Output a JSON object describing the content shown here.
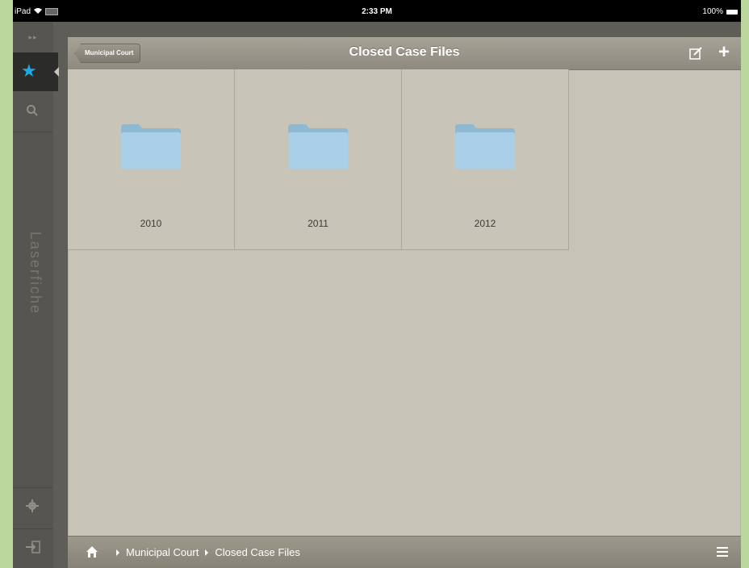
{
  "statusbar": {
    "device": "iPad",
    "time": "2:33 PM",
    "battery": "100%"
  },
  "sidebar": {
    "collapse_label": "▸▸",
    "brand": "Laserfiche"
  },
  "navbar": {
    "back_label": "Municipal Court",
    "title": "Closed Case Files"
  },
  "folders": [
    {
      "label": "2010"
    },
    {
      "label": "2011"
    },
    {
      "label": "2012"
    }
  ],
  "breadcrumb": {
    "items": [
      "Municipal Court",
      "Closed Case Files"
    ]
  },
  "colors": {
    "accent": "#1ea8e8",
    "folder": "#9fc7e0",
    "background": "#c7c3b6"
  },
  "icons": {
    "fav": "star-icon",
    "search": "search-icon",
    "settings": "gear-icon",
    "logout": "logout-icon",
    "home": "home-icon",
    "edit": "edit-icon",
    "add": "plus-icon",
    "list": "list-icon"
  }
}
